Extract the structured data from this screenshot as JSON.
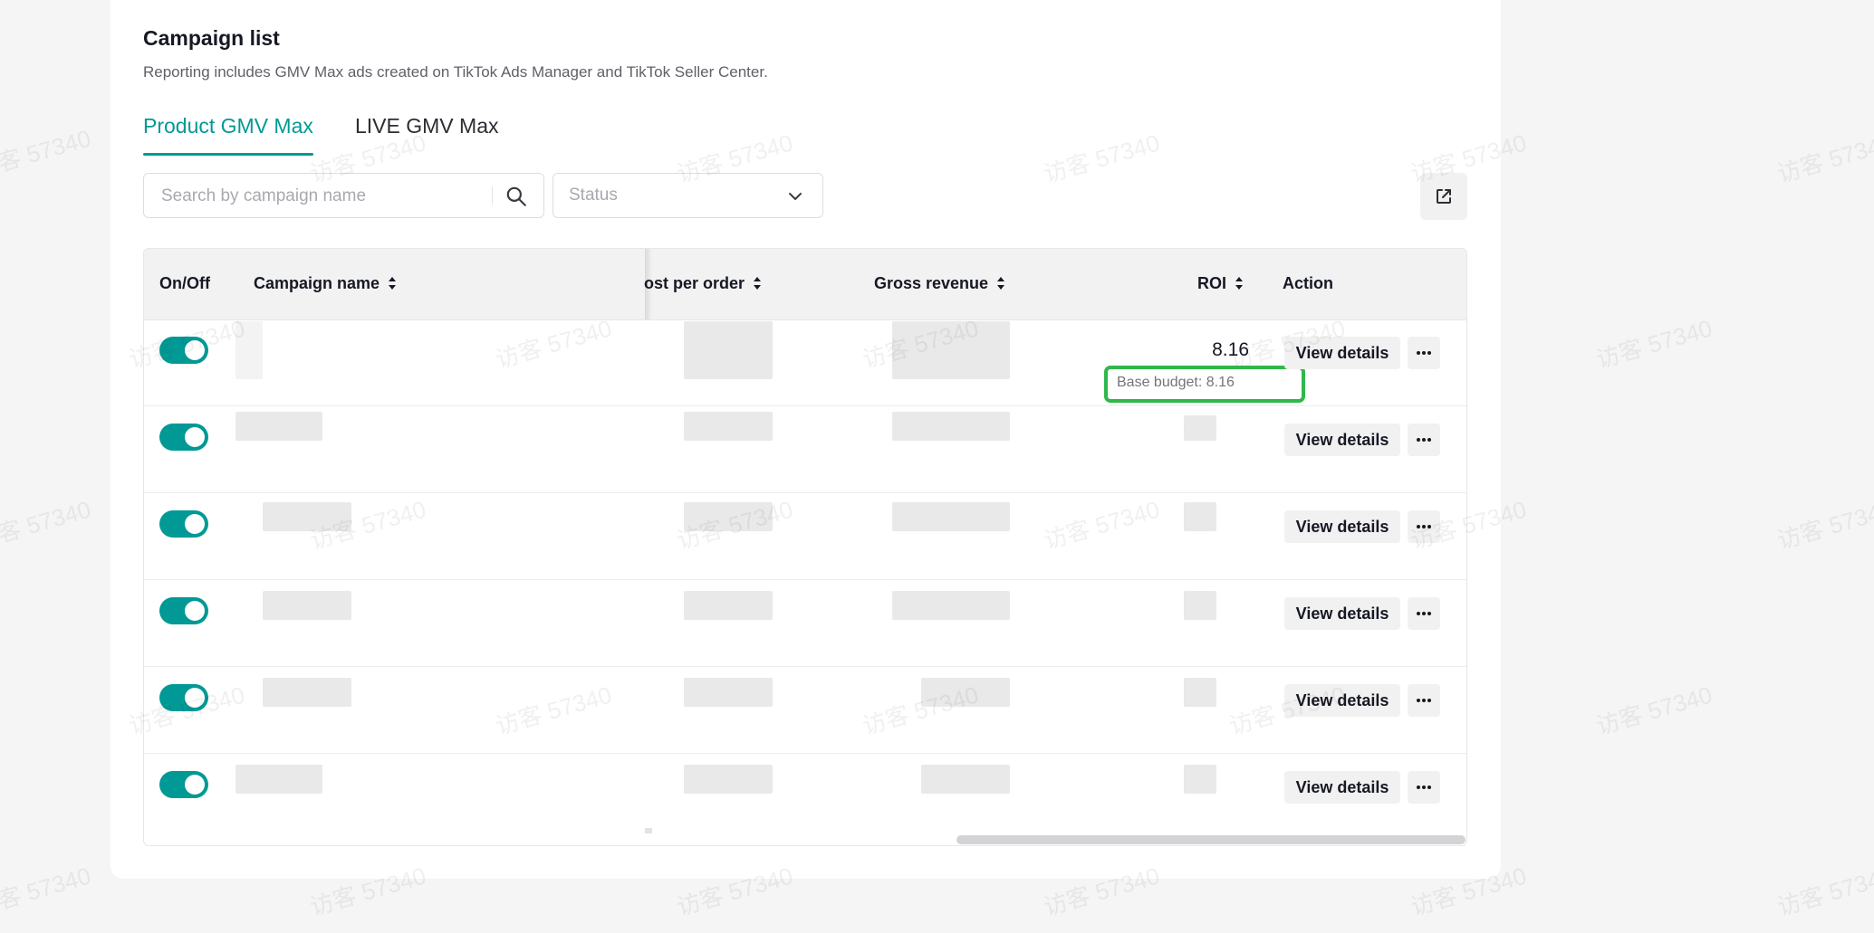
{
  "campaign_list": {
    "title": "Campaign list",
    "subtitle": "Reporting includes GMV Max ads created on TikTok Ads Manager and TikTok Seller Center."
  },
  "tabs": [
    {
      "label": "Product GMV Max",
      "active": true
    },
    {
      "label": "LIVE GMV Max",
      "active": false
    }
  ],
  "search": {
    "placeholder": "Search by campaign name",
    "value": ""
  },
  "status_filter": {
    "placeholder": "Status"
  },
  "table": {
    "columns": {
      "onoff": "On/Off",
      "campaign_name": "Campaign name",
      "cost_per_order": "ost per order",
      "gross_revenue": "Gross revenue",
      "roi": "ROI",
      "action": "Action"
    },
    "rows": [
      {
        "enabled": true,
        "roi": "8.16",
        "base_budget": "Base budget: 8.16",
        "action": "View details"
      },
      {
        "enabled": true,
        "roi": "",
        "action": "View details"
      },
      {
        "enabled": true,
        "roi": "",
        "action": "View details"
      },
      {
        "enabled": true,
        "roi": "",
        "action": "View details"
      },
      {
        "enabled": true,
        "roi": "",
        "action": "View details"
      },
      {
        "enabled": true,
        "roi": "",
        "action": "View details"
      }
    ]
  },
  "watermark": "访客 57340",
  "colors": {
    "accent": "#009995",
    "highlight": "#2fb84a"
  }
}
